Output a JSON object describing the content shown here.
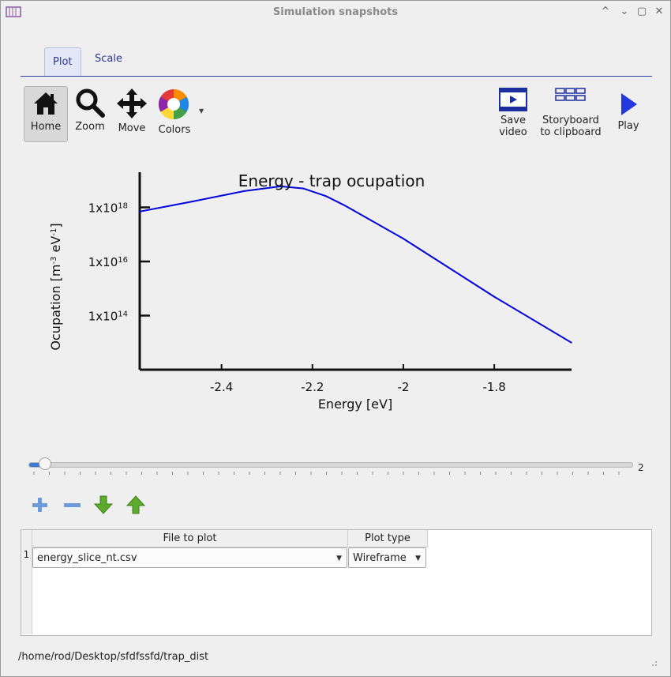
{
  "window": {
    "title": "Simulation snapshots",
    "controls": [
      "^",
      "⌄",
      "▢",
      "✕"
    ]
  },
  "tabs": [
    {
      "label": "Plot",
      "active": true
    },
    {
      "label": "Scale",
      "active": false
    }
  ],
  "toolbar": {
    "home": "Home",
    "zoom": "Zoom",
    "move": "Move",
    "colors": "Colors",
    "save_video_1": "Save",
    "save_video_2": "video",
    "storyboard_1": "Storyboard",
    "storyboard_2": "to clipboard",
    "play": "Play"
  },
  "chart_data": {
    "type": "line",
    "title": "Energy - trap ocupation",
    "xlabel": "Energy [eV]",
    "ylabel": "Ocupation [m-3 eV-1]",
    "ylabel_parts": {
      "a": "Ocupation [m",
      "b": "-3",
      "c": " eV",
      "d": "-1",
      "e": "]"
    },
    "x_ticks": [
      "-2.4",
      "-2.2",
      "-2",
      "-1.8"
    ],
    "x_tick_values": [
      -2.4,
      -2.2,
      -2.0,
      -1.8
    ],
    "y_ticks": [
      {
        "base": "1x10",
        "exp": "18",
        "value": 1e+18
      },
      {
        "base": "1x10",
        "exp": "16",
        "value": 1e+16
      },
      {
        "base": "1x10",
        "exp": "14",
        "value": 100000000000000.0
      }
    ],
    "xlim": [
      -2.58,
      -1.63
    ],
    "ylim_log10": [
      12.0,
      19.3
    ],
    "log_y": true,
    "color": "#0000dd",
    "series": [
      {
        "x": [
          -2.58,
          -2.46,
          -2.35,
          -2.27,
          -2.22,
          -2.17,
          -2.13,
          -2.0,
          -1.8,
          -1.63
        ],
        "y": [
          7e+17,
          1.7e+18,
          4e+18,
          6e+18,
          5e+18,
          2.6e+18,
          1.2e+18,
          7e+16,
          500000000000000.0,
          10000000000000.0
        ]
      }
    ]
  },
  "slider": {
    "value": "2",
    "position": 0.02
  },
  "table": {
    "headers": [
      "File to plot",
      "Plot type"
    ],
    "rows": [
      {
        "num": "1",
        "file": "energy_slice_nt.csv",
        "type": "Wireframe"
      }
    ]
  },
  "status_path": "/home/rod/Desktop/sfdfssfd/trap_dist"
}
